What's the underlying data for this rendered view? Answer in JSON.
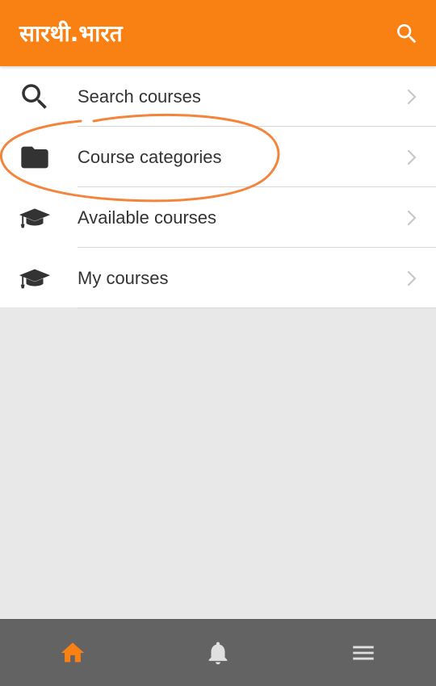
{
  "app": {
    "title": "सारथी.भारत"
  },
  "header": {
    "search_icon": "search-icon"
  },
  "menu": {
    "items": [
      {
        "label": "Search courses",
        "icon": "search-icon"
      },
      {
        "label": "Course categories",
        "icon": "folder-icon"
      },
      {
        "label": "Available courses",
        "icon": "graduation-cap-icon"
      },
      {
        "label": "My courses",
        "icon": "graduation-cap-icon"
      }
    ]
  },
  "annotation": {
    "color": "#f4843c",
    "highlighted_item": "Course categories"
  },
  "bottom_nav": {
    "tabs": [
      {
        "icon": "home-icon",
        "active": true
      },
      {
        "icon": "bell-icon",
        "active": false
      },
      {
        "icon": "menu-icon",
        "active": false
      }
    ]
  },
  "colors": {
    "brand": "#f98012",
    "nav_background": "#636363",
    "nav_icon_inactive": "#e0e0e0",
    "text": "#333333"
  }
}
